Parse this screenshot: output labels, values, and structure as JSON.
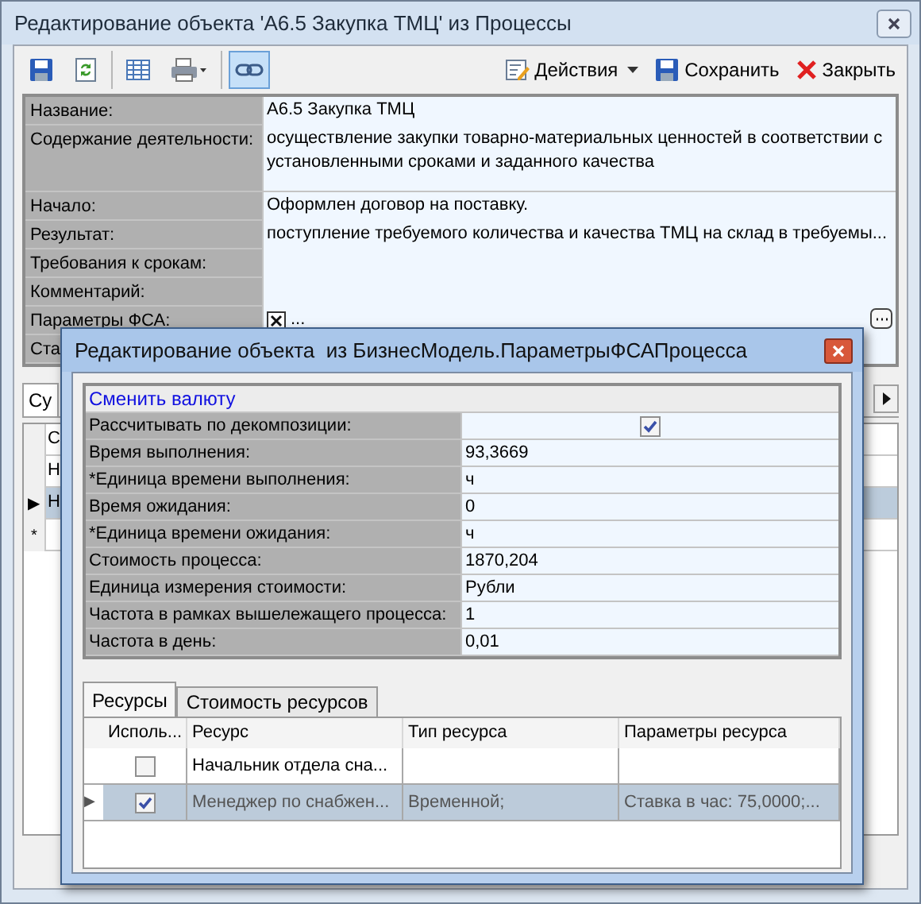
{
  "window": {
    "title": "Редактирование объекта 'А6.5 Закупка ТМЦ' из Процессы"
  },
  "toolbar": {
    "groups": [
      [
        {
          "kind": "save"
        },
        {
          "kind": "refresh"
        }
      ],
      [
        {
          "kind": "table"
        },
        {
          "kind": "print"
        }
      ],
      [
        {
          "kind": "link",
          "pressed": true
        }
      ]
    ],
    "actions": [
      {
        "kind": "menu",
        "label": "Действия"
      },
      {
        "kind": "save",
        "label": "Сохранить"
      },
      {
        "kind": "close",
        "label": "Закрыть"
      }
    ]
  },
  "properties": [
    {
      "kind": "text",
      "label": "Название:",
      "value": "А6.5 Закупка ТМЦ"
    },
    {
      "kind": "memo",
      "label": "Содержание деятельности:",
      "value": "осуществление закупки товарно-материальных ценностей в соответствии с установленными сроками и заданного качества"
    },
    {
      "kind": "text",
      "label": "Начало:",
      "value": "Оформлен договор на поставку."
    },
    {
      "kind": "text",
      "label": "Результат:",
      "value": "поступление требуемого количества и качества ТМЦ на склад в требуемы..."
    },
    {
      "kind": "text",
      "label": "Требования к срокам:"
    },
    {
      "kind": "text",
      "label": "Комментарий:"
    },
    {
      "kind": "object",
      "label": "Параметры ФСА:",
      "value": "..."
    },
    {
      "kind": "text",
      "label": "Ста"
    }
  ],
  "tabs": [
    {
      "label": "Су",
      "selected": true
    }
  ],
  "grid": {
    "rows": [
      {
        "cell": "С",
        "selected": false
      },
      {
        "cell": "Н",
        "selected": false
      },
      {
        "marker": "▶",
        "cell": "Н",
        "selected": true
      },
      {
        "marker": "*",
        "selected": false
      }
    ]
  },
  "dialog": {
    "title": "Редактирование объекта  из БизнесМодель.ПараметрыФСАПроцесса",
    "link": "Сменить валюту",
    "properties": [
      {
        "kind": "checkbox",
        "label": "Рассчитывать по декомпозиции:",
        "checked": true
      },
      {
        "kind": "text",
        "label": "Время выполнения:",
        "value": "93,3669"
      },
      {
        "kind": "text",
        "label": "*Единица времени выполнения:",
        "value": "ч"
      },
      {
        "kind": "text",
        "label": "Время ожидания:",
        "value": "0"
      },
      {
        "kind": "text",
        "label": "*Единица времени ожидания:",
        "value": "ч"
      },
      {
        "kind": "text",
        "label": "Стоимость процесса:",
        "value": "1870,204"
      },
      {
        "kind": "text",
        "label": "Единица измерения стоимости:",
        "value": "Рубли"
      },
      {
        "kind": "text",
        "label": "Частота в рамках вышележащего процесса:",
        "value": "1"
      },
      {
        "kind": "text",
        "label": "Частота в день:",
        "value": "0,01"
      }
    ],
    "tabs": [
      {
        "label": "Ресурсы",
        "selected": true
      },
      {
        "label": "Стоимость ресурсов",
        "selected": false
      }
    ],
    "table": {
      "columns": [
        "Исполь...",
        "Ресурс",
        "Тип ресурса",
        "Параметры ресурса"
      ],
      "rows": [
        {
          "used": false,
          "selected": false,
          "resource": "Начальник отдела сна..."
        },
        {
          "marker": "▶",
          "used": true,
          "selected": true,
          "resource": "Менеджер по снабжен...",
          "resource_type": "Временной;",
          "parameters": "Ставка в час: 75,0000;..."
        }
      ]
    }
  }
}
